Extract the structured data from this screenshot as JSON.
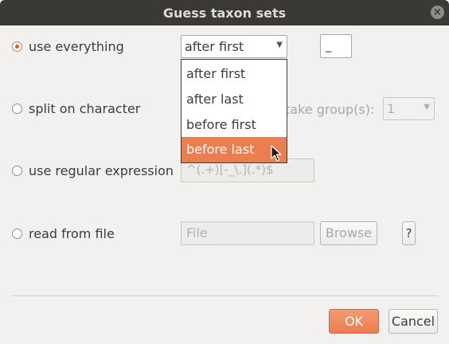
{
  "dialog": {
    "title": "Guess taxon sets",
    "close_label": "×"
  },
  "options": {
    "use_everything": {
      "label": "use everything",
      "checked": true,
      "mode_value": "after first",
      "separator_value": "_"
    },
    "split_on_character": {
      "label": "split on character",
      "checked": false,
      "take_groups_label": "take group(s):",
      "take_groups_value": "1"
    },
    "use_regex": {
      "label": "use regular expression",
      "checked": false,
      "regex_value": "^(.+)[-_\\.](.*)$"
    },
    "read_from_file": {
      "label": "read from file",
      "checked": false,
      "file_placeholder": "File",
      "browse_label": "Browse",
      "help_label": "?"
    }
  },
  "dropdown": {
    "items": [
      "after first",
      "after last",
      "before first",
      "before last"
    ],
    "highlighted": "before last"
  },
  "buttons": {
    "ok_label": "OK",
    "cancel_label": "Cancel"
  },
  "colors": {
    "accent": "#e95420",
    "highlight": "#ec7d4f",
    "titlebar": "#3a3935"
  }
}
